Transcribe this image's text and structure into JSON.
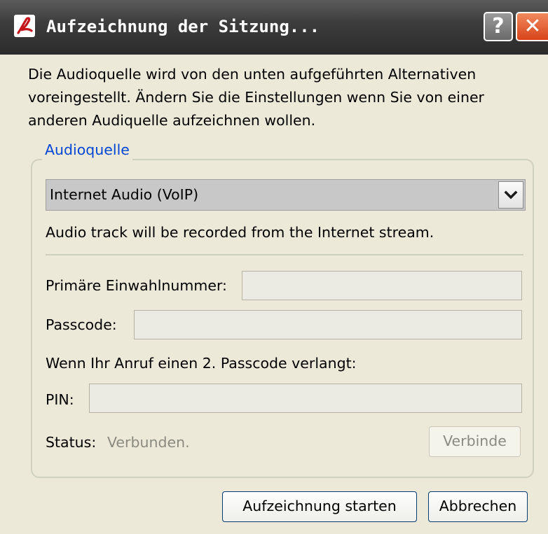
{
  "window": {
    "title": "Aufzeichnung der Sitzung...",
    "help_label": "?",
    "close_label": "✕"
  },
  "intro_text": "Die Audioquelle wird von den unten aufgeführten Alternativen voreingestellt. Ändern Sie die Einstellungen wenn Sie von einer anderen Audiquelle aufzeichnen wollen.",
  "audio_source": {
    "group_label": "Audioquelle",
    "selected": "Internet Audio (VoIP)",
    "description": "Audio track will be recorded from the Internet stream."
  },
  "dial_in": {
    "primary_label": "Primäre Einwahlnummer:",
    "primary_value": "",
    "passcode_label": "Passcode:",
    "passcode_value": "",
    "second_passcode_note": "Wenn Ihr Anruf einen 2. Passcode verlangt:",
    "pin_label": "PIN:",
    "pin_value": ""
  },
  "status": {
    "label": "Status:",
    "value": "Verbunden.",
    "connect_button": "Verbinde"
  },
  "actions": {
    "start_button": "Aufzeichnung starten",
    "cancel_button": "Abbrechen"
  },
  "colors": {
    "titlebar": "#3d3d3d",
    "dialog_bg": "#ece9d8",
    "group_label": "#0046d5",
    "close_button": "#d8431b"
  }
}
